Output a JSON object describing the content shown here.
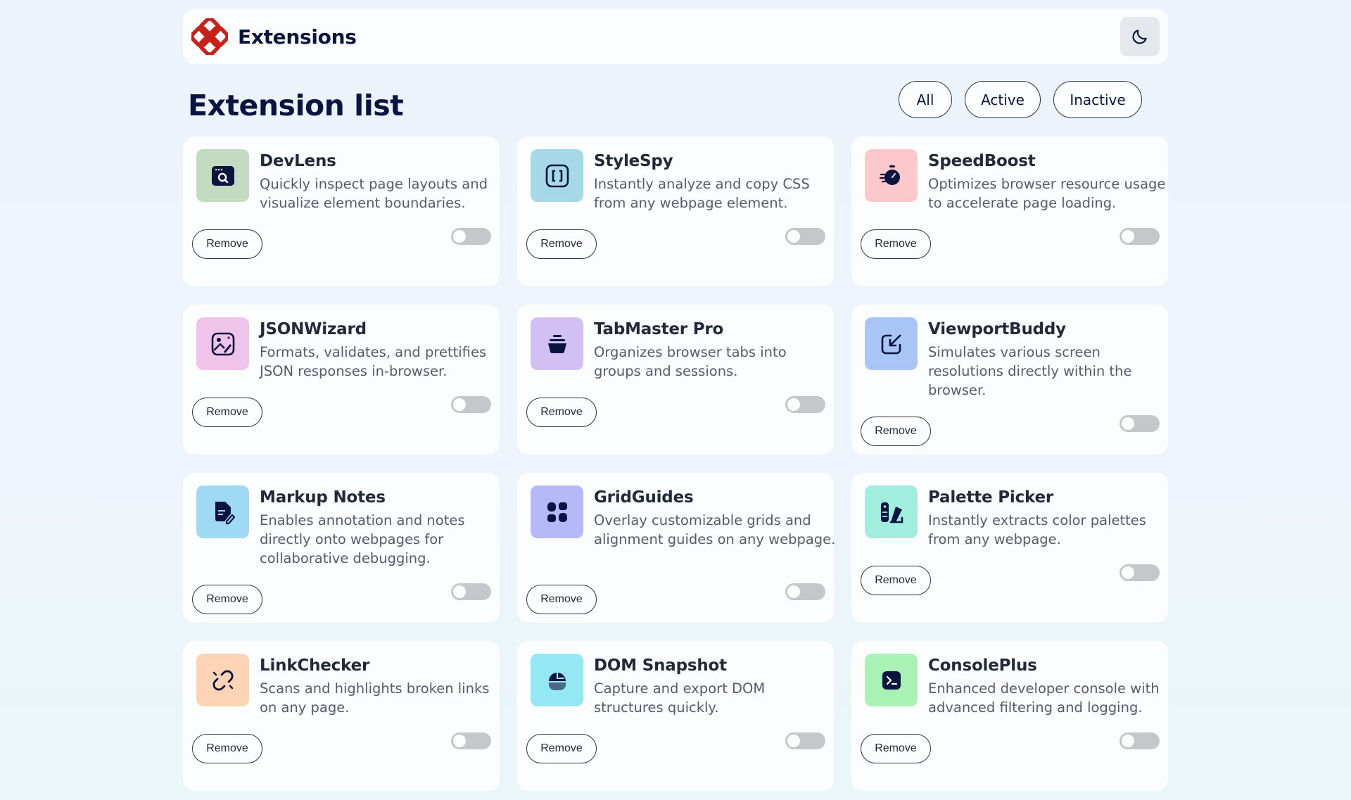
{
  "header": {
    "title": "Extensions",
    "logo_icon": "flower-logo-icon",
    "theme_icon": "moon-icon",
    "colors": {
      "logo": "#c7221a",
      "text": "#091540",
      "theme_button_bg": "#e4e7ec"
    }
  },
  "main": {
    "title": "Extension list",
    "filters": [
      {
        "label": "All"
      },
      {
        "label": "Active"
      },
      {
        "label": "Inactive"
      }
    ]
  },
  "extensions": [
    {
      "name": "DevLens",
      "description": "Quickly inspect page layouts and visualize element boundaries.",
      "icon": "browser-search-icon",
      "tile_color": "#c2dbc1",
      "remove_label": "Remove",
      "enabled": false
    },
    {
      "name": "StyleSpy",
      "description": "Instantly analyze and copy CSS from any webpage element.",
      "icon": "brackets-icon",
      "tile_color": "#a6d8e7",
      "remove_label": "Remove",
      "enabled": false
    },
    {
      "name": "SpeedBoost",
      "description": "Optimizes browser resource usage to accelerate page loading.",
      "icon": "stopwatch-icon",
      "tile_color": "#fcc8cc",
      "remove_label": "Remove",
      "enabled": false
    },
    {
      "name": "JSONWizard",
      "description": "Formats, validates, and prettifies JSON responses in-browser.",
      "icon": "magic-image-icon",
      "tile_color": "#f0c3ea",
      "remove_label": "Remove",
      "enabled": false
    },
    {
      "name": "TabMaster Pro",
      "description": "Organizes browser tabs into groups and sessions.",
      "icon": "basket-icon",
      "tile_color": "#d1c0f1",
      "remove_label": "Remove",
      "enabled": false
    },
    {
      "name": "ViewportBuddy",
      "description": "Simulates various screen resolutions directly within the browser.",
      "icon": "resize-arrow-icon",
      "tile_color": "#a9c5f6",
      "remove_label": "Remove",
      "enabled": false
    },
    {
      "name": "Markup Notes",
      "description": "Enables annotation and notes directly onto webpages for collaborative debugging.",
      "icon": "note-pencil-icon",
      "tile_color": "#9fd9f3",
      "remove_label": "Remove",
      "enabled": false
    },
    {
      "name": "GridGuides",
      "description": "Overlay customizable grids and alignment guides on any webpage.",
      "icon": "grid-icon",
      "tile_color": "#b6b9f7",
      "remove_label": "Remove",
      "enabled": false
    },
    {
      "name": "Palette Picker",
      "description": "Instantly extracts color palettes from any webpage.",
      "icon": "palette-icon",
      "tile_color": "#a2eede",
      "remove_label": "Remove",
      "enabled": false
    },
    {
      "name": "LinkChecker",
      "description": "Scans and highlights broken links on any page.",
      "icon": "broken-link-icon",
      "tile_color": "#fdd5b6",
      "remove_label": "Remove",
      "enabled": false
    },
    {
      "name": "DOM Snapshot",
      "description": "Capture and export DOM structures quickly.",
      "icon": "camera-dome-icon",
      "tile_color": "#94e8f3",
      "remove_label": "Remove",
      "enabled": false
    },
    {
      "name": "ConsolePlus",
      "description": "Enhanced developer console with advanced filtering and logging.",
      "icon": "terminal-icon",
      "tile_color": "#a9f1b4",
      "remove_label": "Remove",
      "enabled": false
    }
  ]
}
